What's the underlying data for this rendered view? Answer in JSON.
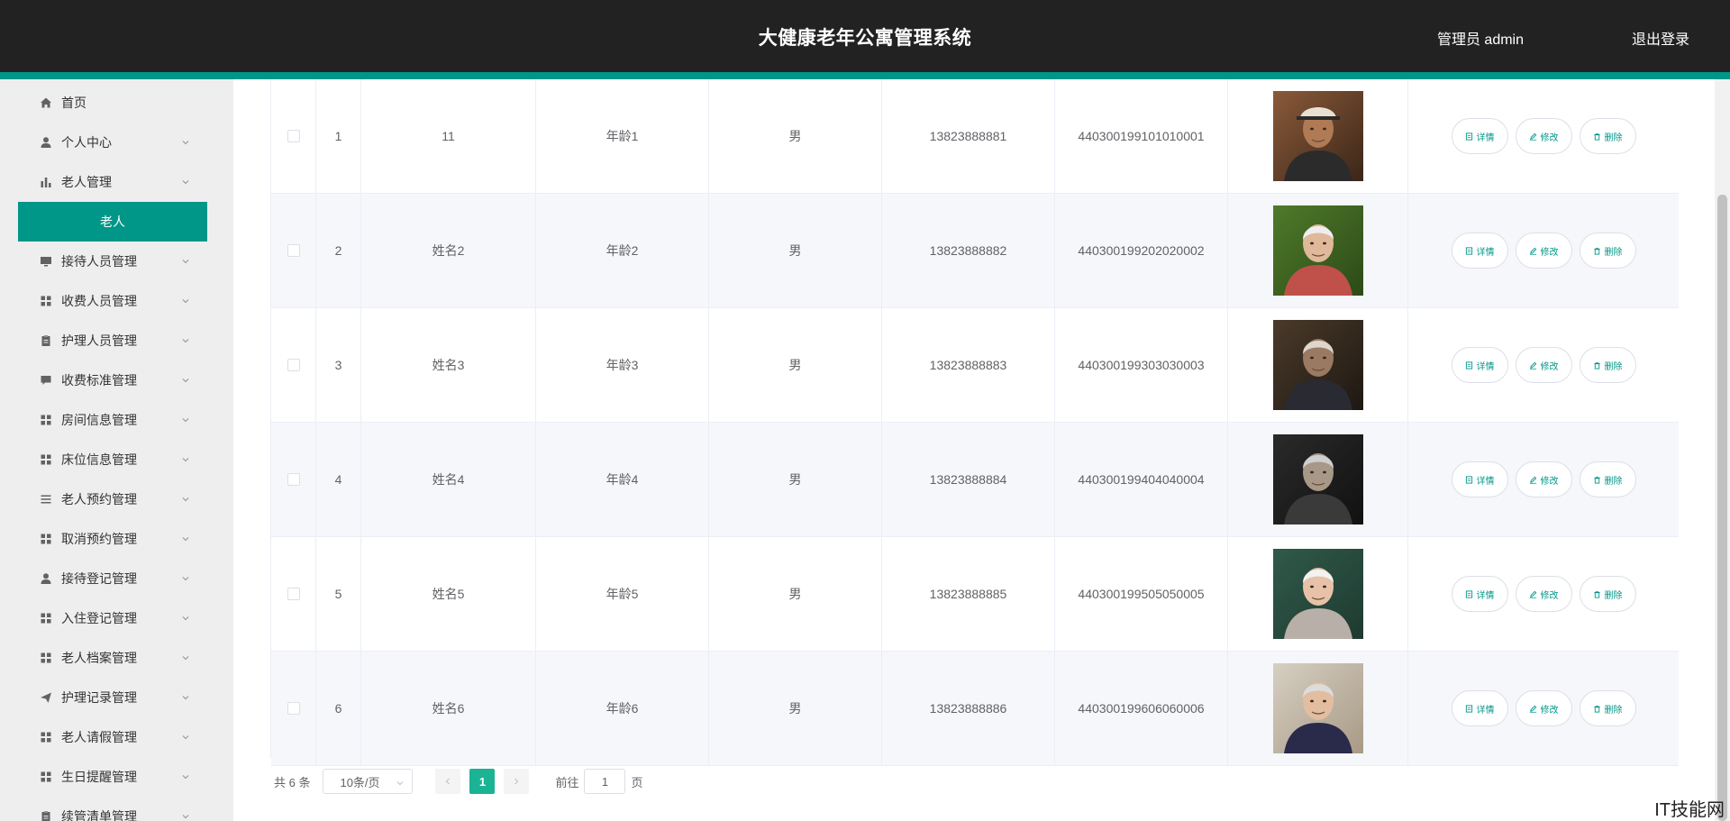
{
  "header": {
    "title": "大健康老年公寓管理系统",
    "user": "管理员 admin",
    "logout": "退出登录"
  },
  "colors": {
    "header_bg": "#222222",
    "accent": "#009688",
    "sidebar_bg": "#eeeeee",
    "pager_active": "#1ab394"
  },
  "sidebar": {
    "items": [
      {
        "label": "首页",
        "icon": "home-icon",
        "expandable": false
      },
      {
        "label": "个人中心",
        "icon": "user-icon",
        "expandable": true
      },
      {
        "label": "老人管理",
        "icon": "bar-chart-icon",
        "expandable": true
      },
      {
        "label": "老人",
        "icon": "",
        "expandable": false,
        "active": true
      },
      {
        "label": "接待人员管理",
        "icon": "monitor-icon",
        "expandable": true
      },
      {
        "label": "收费人员管理",
        "icon": "grid-icon",
        "expandable": true
      },
      {
        "label": "护理人员管理",
        "icon": "clipboard-icon",
        "expandable": true
      },
      {
        "label": "收费标准管理",
        "icon": "chat-icon",
        "expandable": true
      },
      {
        "label": "房间信息管理",
        "icon": "grid-icon",
        "expandable": true
      },
      {
        "label": "床位信息管理",
        "icon": "grid-icon",
        "expandable": true
      },
      {
        "label": "老人预约管理",
        "icon": "list-icon",
        "expandable": true
      },
      {
        "label": "取消预约管理",
        "icon": "grid-icon",
        "expandable": true
      },
      {
        "label": "接待登记管理",
        "icon": "user-icon",
        "expandable": true
      },
      {
        "label": "入住登记管理",
        "icon": "grid-icon",
        "expandable": true
      },
      {
        "label": "老人档案管理",
        "icon": "grid-icon",
        "expandable": true
      },
      {
        "label": "护理记录管理",
        "icon": "send-icon",
        "expandable": true
      },
      {
        "label": "老人请假管理",
        "icon": "grid-icon",
        "expandable": true
      },
      {
        "label": "生日提醒管理",
        "icon": "grid-icon",
        "expandable": true
      },
      {
        "label": "续管清单管理",
        "icon": "clipboard-icon",
        "expandable": true
      }
    ]
  },
  "table": {
    "rows": [
      {
        "index": "1",
        "name": "11",
        "age": "年龄1",
        "gender": "男",
        "phone": "13823888881",
        "id_card": "440300199101010001",
        "photo": "photo-1"
      },
      {
        "index": "2",
        "name": "姓名2",
        "age": "年龄2",
        "gender": "男",
        "phone": "13823888882",
        "id_card": "440300199202020002",
        "photo": "photo-2"
      },
      {
        "index": "3",
        "name": "姓名3",
        "age": "年龄3",
        "gender": "男",
        "phone": "13823888883",
        "id_card": "440300199303030003",
        "photo": "photo-3"
      },
      {
        "index": "4",
        "name": "姓名4",
        "age": "年龄4",
        "gender": "男",
        "phone": "13823888884",
        "id_card": "440300199404040004",
        "photo": "photo-4"
      },
      {
        "index": "5",
        "name": "姓名5",
        "age": "年龄5",
        "gender": "男",
        "phone": "13823888885",
        "id_card": "440300199505050005",
        "photo": "photo-5"
      },
      {
        "index": "6",
        "name": "姓名6",
        "age": "年龄6",
        "gender": "男",
        "phone": "13823888886",
        "id_card": "440300199606060006",
        "photo": "photo-6"
      }
    ],
    "actions": {
      "detail": "详情",
      "edit": "修改",
      "delete": "删除"
    }
  },
  "pager": {
    "total": "共 6 条",
    "page_size": "10条/页",
    "current_page": "1",
    "goto_label": "前往",
    "goto_value": "1",
    "page_unit": "页"
  },
  "watermark": "IT技能网"
}
